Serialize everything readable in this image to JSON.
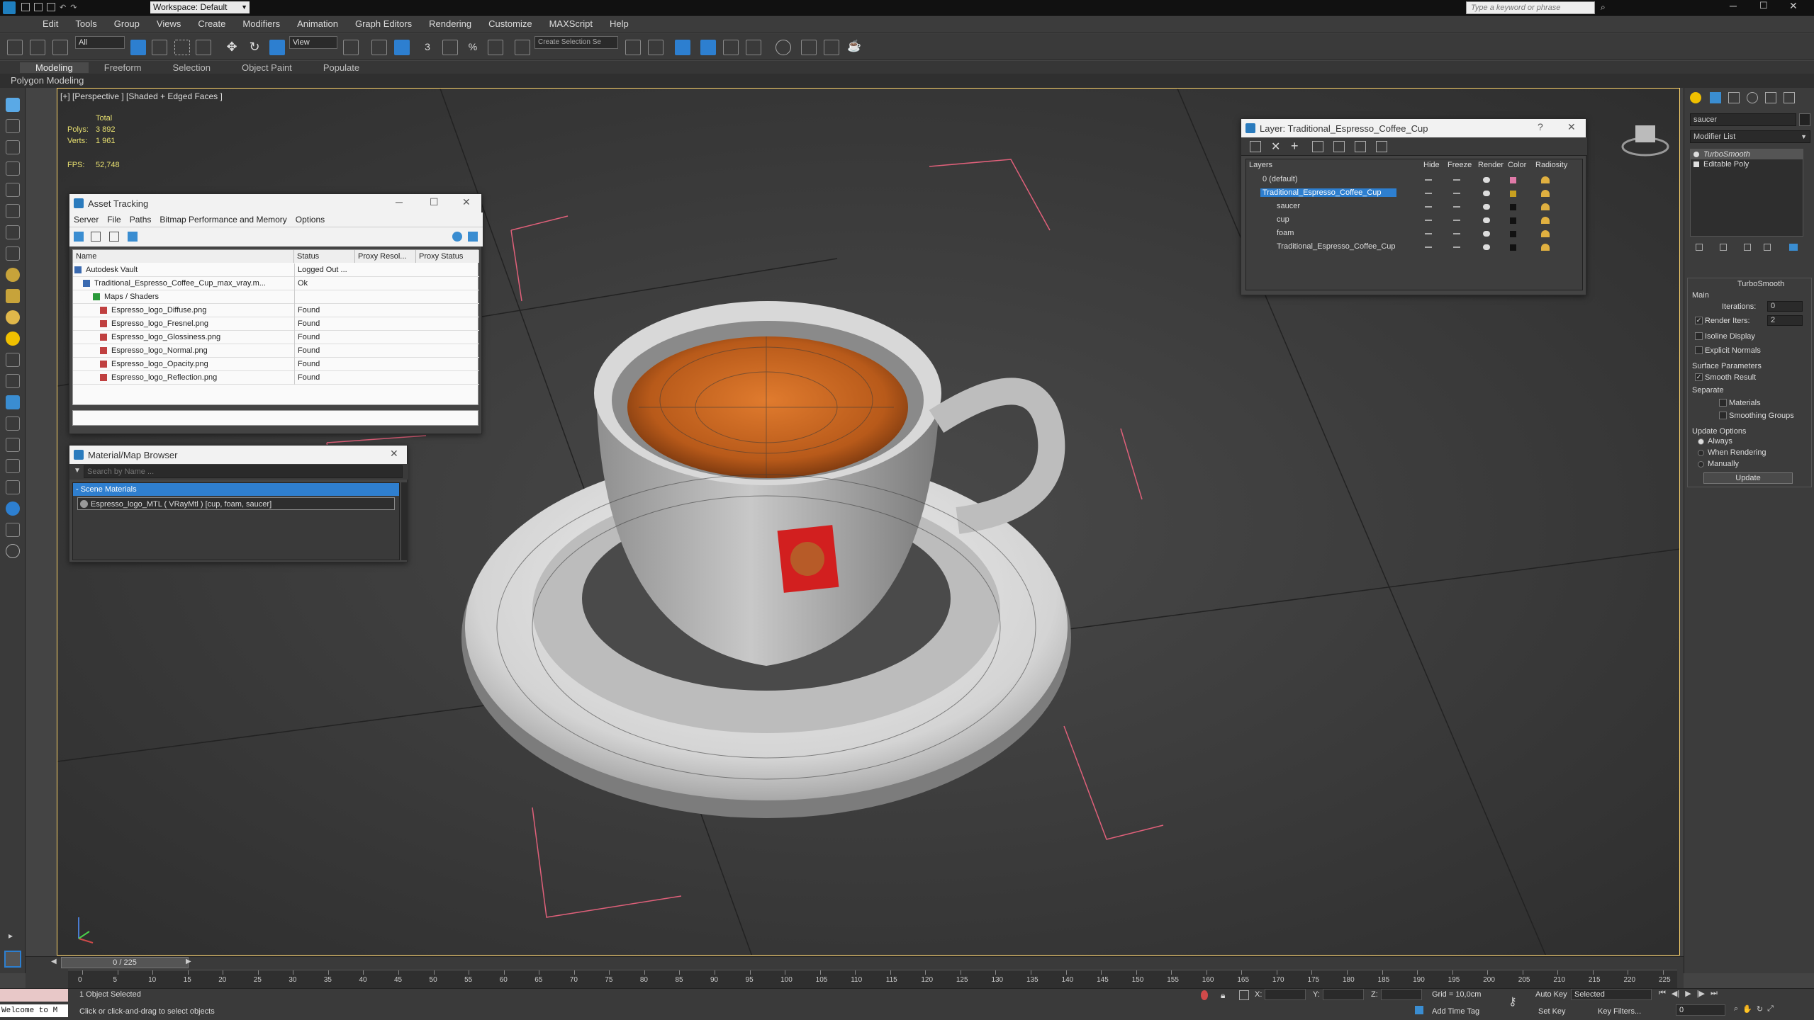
{
  "titlebar": {
    "workspace": "Workspace: Default",
    "search_placeholder": "Type a keyword or phrase"
  },
  "menu": [
    "Edit",
    "Tools",
    "Group",
    "Views",
    "Create",
    "Modifiers",
    "Animation",
    "Graph Editors",
    "Rendering",
    "Customize",
    "MAXScript",
    "Help"
  ],
  "toolbar": {
    "selection_filter": "All",
    "ref_coord": "View",
    "named_selection": "Create Selection Se"
  },
  "ribbon": {
    "tabs": [
      "Modeling",
      "Freeform",
      "Selection",
      "Object Paint",
      "Populate"
    ],
    "sub": "Polygon Modeling"
  },
  "viewport": {
    "label": "[+] [Perspective ] [Shaded + Edged Faces ]",
    "stats_total": "Total",
    "polys_label": "Polys:",
    "polys": "3 892",
    "verts_label": "Verts:",
    "verts": "1 961",
    "fps_label": "FPS:",
    "fps": "52,748"
  },
  "asset_tracking": {
    "title": "Asset Tracking",
    "menu": [
      "Server",
      "File",
      "Paths",
      "Bitmap Performance and Memory",
      "Options"
    ],
    "columns": [
      "Name",
      "Status",
      "Proxy Resol...",
      "Proxy Status"
    ],
    "rows": [
      {
        "name": "Autodesk Vault",
        "status": "Logged Out ..."
      },
      {
        "name": "Traditional_Espresso_Coffee_Cup_max_vray.m...",
        "status": "Ok"
      },
      {
        "name": "Maps / Shaders",
        "status": ""
      },
      {
        "name": "Espresso_logo_Diffuse.png",
        "status": "Found"
      },
      {
        "name": "Espresso_logo_Fresnel.png",
        "status": "Found"
      },
      {
        "name": "Espresso_logo_Glossiness.png",
        "status": "Found"
      },
      {
        "name": "Espresso_logo_Normal.png",
        "status": "Found"
      },
      {
        "name": "Espresso_logo_Opacity.png",
        "status": "Found"
      },
      {
        "name": "Espresso_logo_Reflection.png",
        "status": "Found"
      }
    ]
  },
  "material_browser": {
    "title": "Material/Map Browser",
    "search_placeholder": "Search by Name ...",
    "section": "- Scene Materials",
    "item": "Espresso_logo_MTL  ( VRayMtl ) [cup, foam, saucer]"
  },
  "layer_window": {
    "title": "Layer: Traditional_Espresso_Coffee_Cup",
    "columns": [
      "Layers",
      "Hide",
      "Freeze",
      "Render",
      "Color",
      "Radiosity"
    ],
    "rows": [
      {
        "name": "0 (default)",
        "color": "#e07aa8"
      },
      {
        "name": "Traditional_Espresso_Coffee_Cup",
        "color": "#c8a020"
      },
      {
        "name": "saucer",
        "color": "#111111"
      },
      {
        "name": "cup",
        "color": "#111111"
      },
      {
        "name": "foam",
        "color": "#111111"
      },
      {
        "name": "Traditional_Espresso_Coffee_Cup",
        "color": "#111111"
      }
    ]
  },
  "command_panel": {
    "object_name": "saucer",
    "modifier_list": "Modifier List",
    "stack": [
      "TurboSmooth",
      "Editable Poly"
    ],
    "rollout_title": "TurboSmooth",
    "main": "Main",
    "iterations_label": "Iterations:",
    "iterations": "0",
    "render_iters_label": "Render Iters:",
    "render_iters": "2",
    "isoline": "Isoline Display",
    "explicit": "Explicit Normals",
    "surface_params": "Surface Parameters",
    "smooth_result": "Smooth Result",
    "separate": "Separate",
    "materials": "Materials",
    "smoothing_groups": "Smoothing Groups",
    "update_options": "Update Options",
    "always": "Always",
    "when_rendering": "When Rendering",
    "manually": "Manually",
    "update_btn": "Update"
  },
  "timeline": {
    "frame": "0 / 225",
    "ticks": [
      "0",
      "5",
      "10",
      "15",
      "20",
      "25",
      "30",
      "35",
      "40",
      "45",
      "50",
      "55",
      "60",
      "65",
      "70",
      "75",
      "80",
      "85",
      "90",
      "95",
      "100",
      "105",
      "110",
      "115",
      "120",
      "125",
      "130",
      "135",
      "140",
      "145",
      "150",
      "155",
      "160",
      "165",
      "170",
      "175",
      "180",
      "185",
      "190",
      "195",
      "200",
      "205",
      "210",
      "215",
      "220",
      "225"
    ]
  },
  "status": {
    "maxscript": "Welcome to M",
    "selected": "1 Object Selected",
    "prompt": "Click or click-and-drag to select objects",
    "x_label": "X:",
    "y_label": "Y:",
    "z_label": "Z:",
    "grid": "Grid = 10,0cm",
    "add_time_tag": "Add Time Tag",
    "auto_key": "Auto Key",
    "set_key": "Set Key",
    "key_mode": "Selected",
    "key_filters": "Key Filters...",
    "frame_field": "0"
  }
}
